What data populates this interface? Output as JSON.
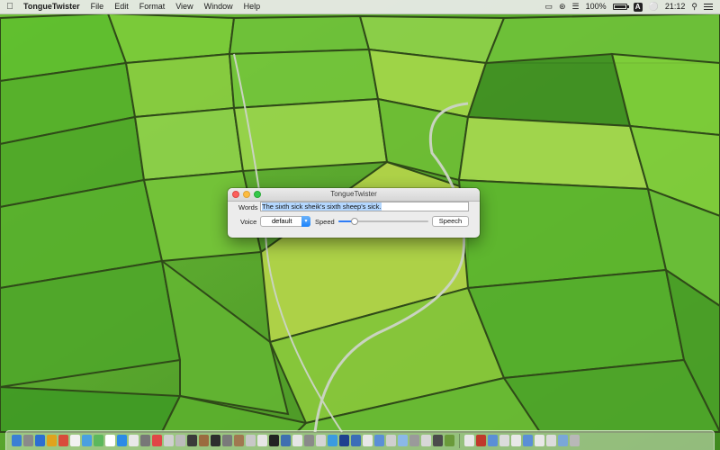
{
  "menubar": {
    "apple_icon": "apple-icon",
    "app_name": "TongueTwister",
    "menus": [
      "File",
      "Edit",
      "Format",
      "View",
      "Window",
      "Help"
    ],
    "status": {
      "battery_percent": "100%",
      "input_source": "A",
      "clock": "21:12"
    }
  },
  "window": {
    "title": "TongueTwister",
    "words_label": "Words",
    "words_value": "The sixth sick sheik's sixth sheep's sick.",
    "voice_label": "Voice",
    "voice_value": "default",
    "speed_label": "Speed",
    "speed_level": 0.18,
    "speech_button": "Speech"
  },
  "dock": {
    "left_icons": [
      "#3b7fd4",
      "#8a8a8a",
      "#2c6fd1",
      "#e0a31c",
      "#d84b3a",
      "#f2f2f2",
      "#4aa0e0",
      "#5cb85c",
      "#ffffff",
      "#2b8be6",
      "#e8e8e8",
      "#777777",
      "#e14646",
      "#d0d0d0",
      "#bbbbbb",
      "#3a3a3a",
      "#9b6b3f",
      "#2d2d2d",
      "#7a7a7a",
      "#a07850",
      "#c8c8c8",
      "#e6e6e6",
      "#222222",
      "#3f6fb0",
      "#e6e6e6",
      "#8a8a8a",
      "#d5d5d5",
      "#3b9be0",
      "#1f3f8f",
      "#3b6db8",
      "#e8e8e8",
      "#5b8fd6",
      "#cfcfcf",
      "#8bb8e8",
      "#9a9a9a",
      "#d7d7d7",
      "#4b4b4b",
      "#6a9a3a"
    ],
    "right_icons": [
      "#e8e8e8",
      "#c0392b",
      "#5b8fd6",
      "#dcdcdc",
      "#e8e8e8",
      "#5b8fd6",
      "#e8e8e8",
      "#dcdcdc",
      "#7aa7d8",
      "#b8b8b8"
    ]
  }
}
